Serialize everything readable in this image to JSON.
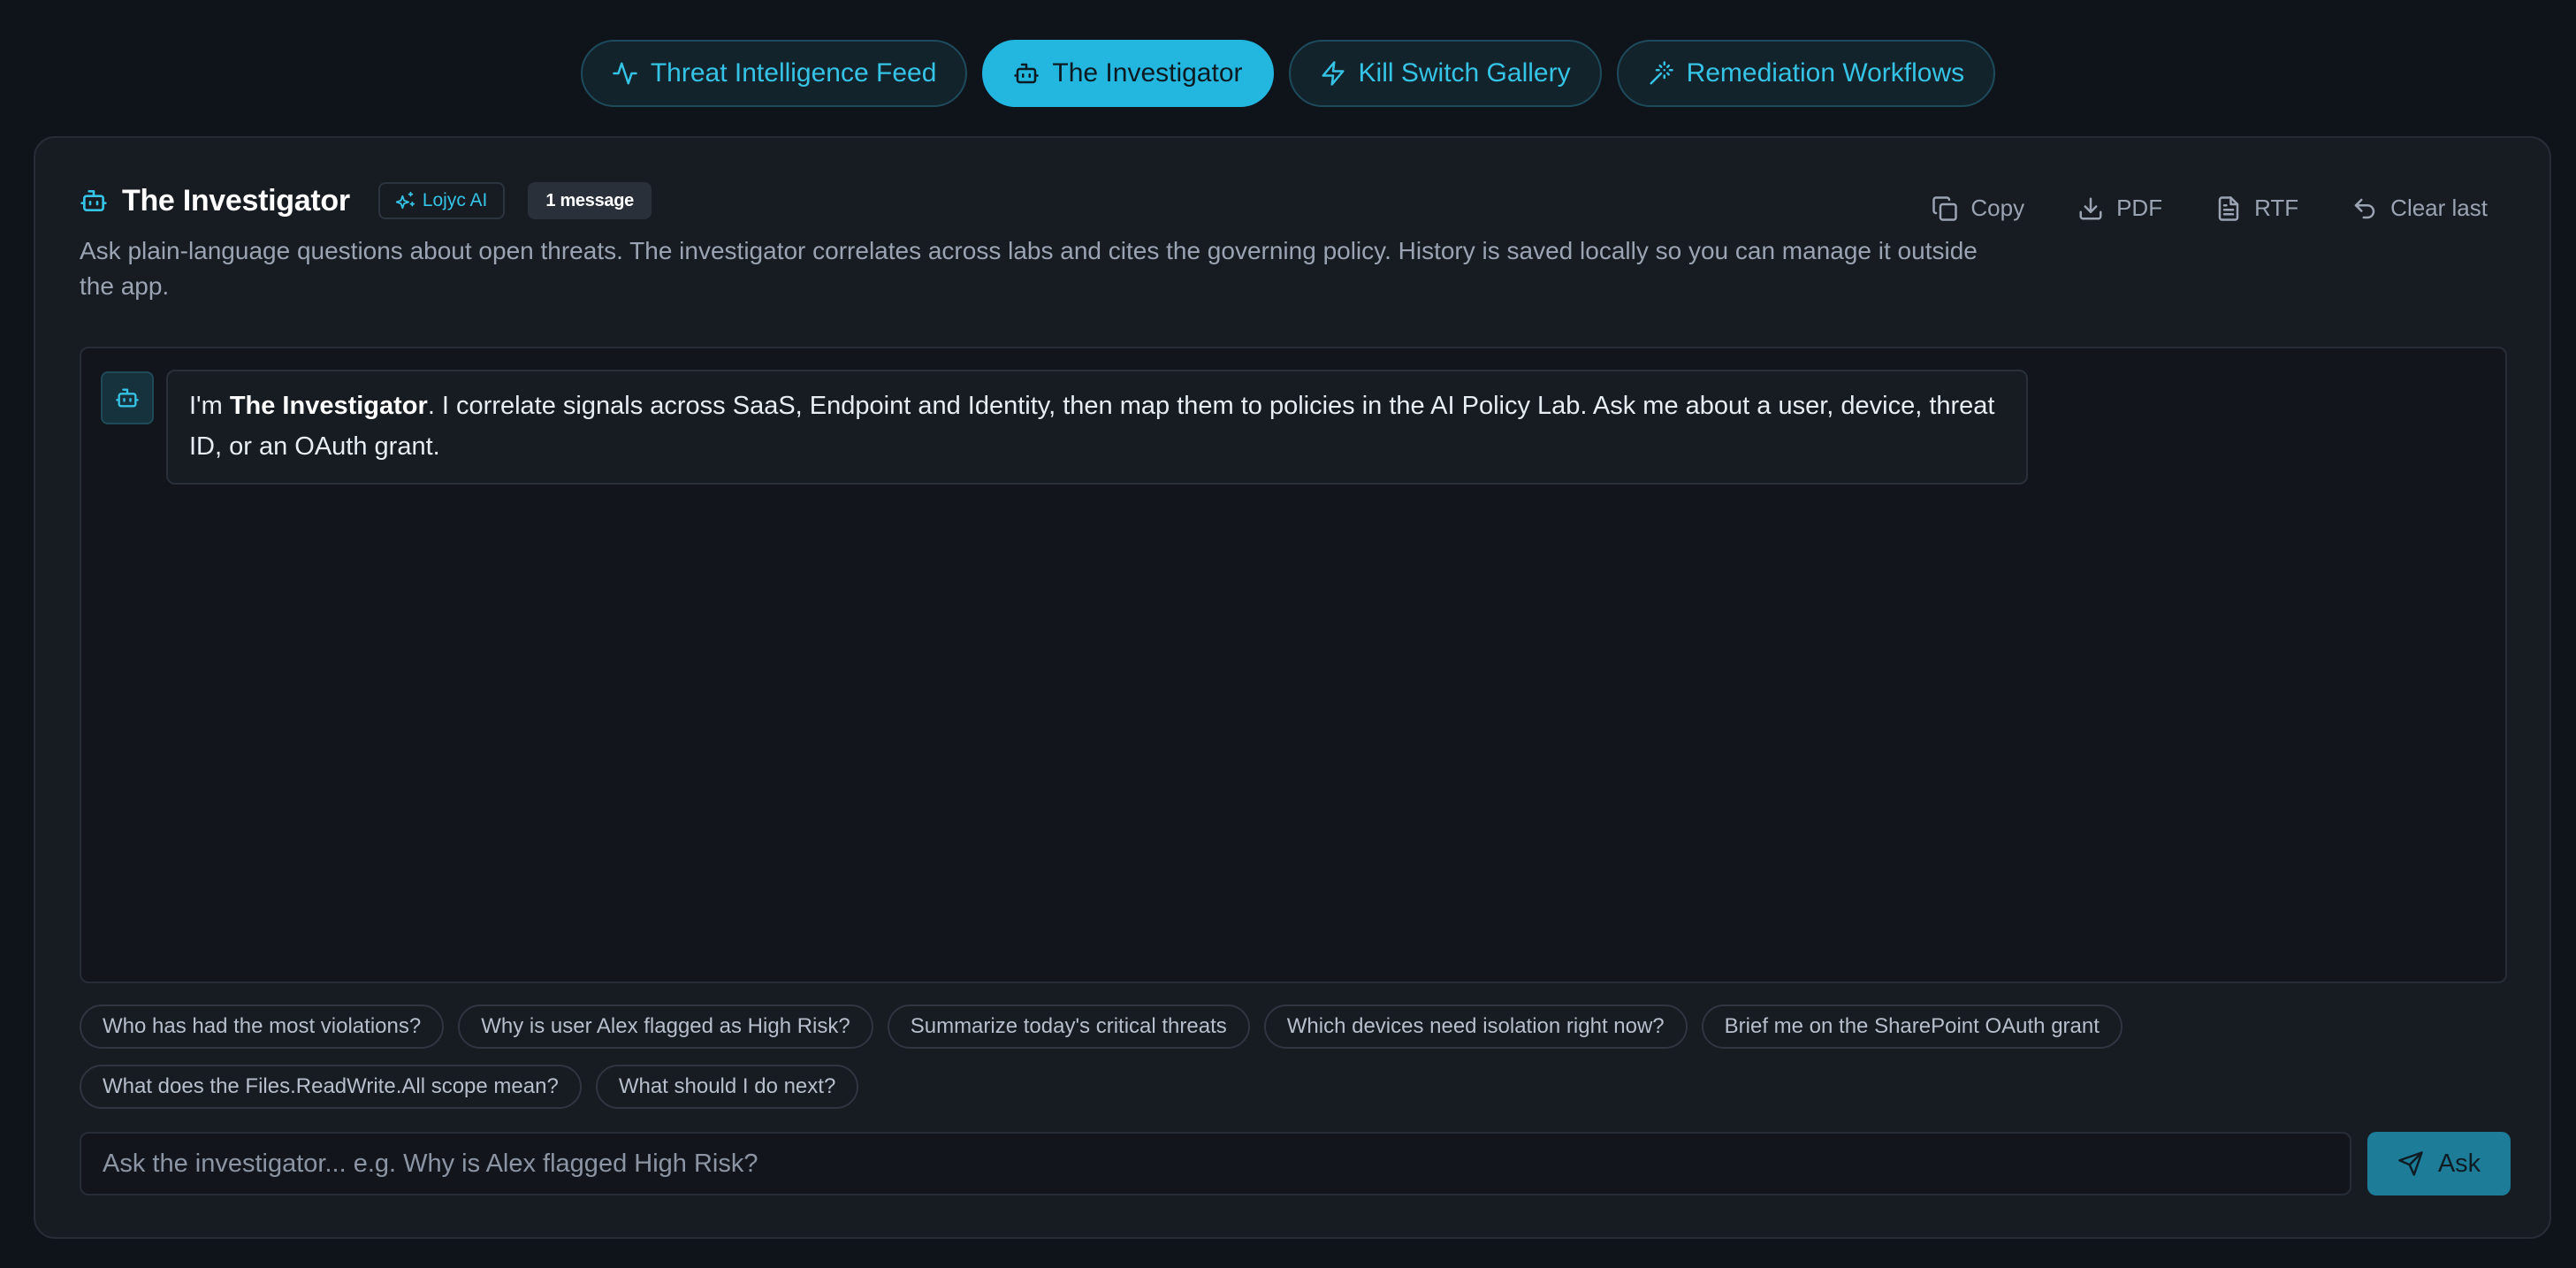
{
  "tabs": [
    {
      "label": "Threat Intelligence Feed",
      "icon": "activity-icon",
      "active": false
    },
    {
      "label": "The Investigator",
      "icon": "bot-icon",
      "active": true
    },
    {
      "label": "Kill Switch Gallery",
      "icon": "zap-icon",
      "active": false
    },
    {
      "label": "Remediation Workflows",
      "icon": "wand-icon",
      "active": false
    }
  ],
  "header": {
    "title": "The Investigator",
    "brand_badge": "Lojyc AI",
    "message_count": "1 message",
    "subtitle": "Ask plain-language questions about open threats. The investigator correlates across labs and cites the governing policy. History is saved locally so you can manage it outside the app."
  },
  "actions": {
    "copy": "Copy",
    "pdf": "PDF",
    "rtf": "RTF",
    "clear_last": "Clear last"
  },
  "chat": {
    "messages": [
      {
        "role": "assistant",
        "prefix": "I'm ",
        "bold": "The Investigator",
        "text": ". I correlate signals across SaaS, Endpoint and Identity, then map them to policies in the AI Policy Lab. Ask me about a user, device, threat ID, or an OAuth grant."
      }
    ]
  },
  "suggestions": [
    "Who has had the most violations?",
    "Why is user Alex flagged as High Risk?",
    "Summarize today's critical threats",
    "Which devices need isolation right now?",
    "Brief me on the SharePoint OAuth grant",
    "What does the Files.ReadWrite.All scope mean?",
    "What should I do next?"
  ],
  "input": {
    "placeholder": "Ask the investigator... e.g. Why is Alex flagged High Risk?",
    "value": "",
    "button_label": "Ask"
  },
  "colors": {
    "accent": "#23b7e0",
    "background": "#0f141b",
    "panel": "#171b22"
  }
}
